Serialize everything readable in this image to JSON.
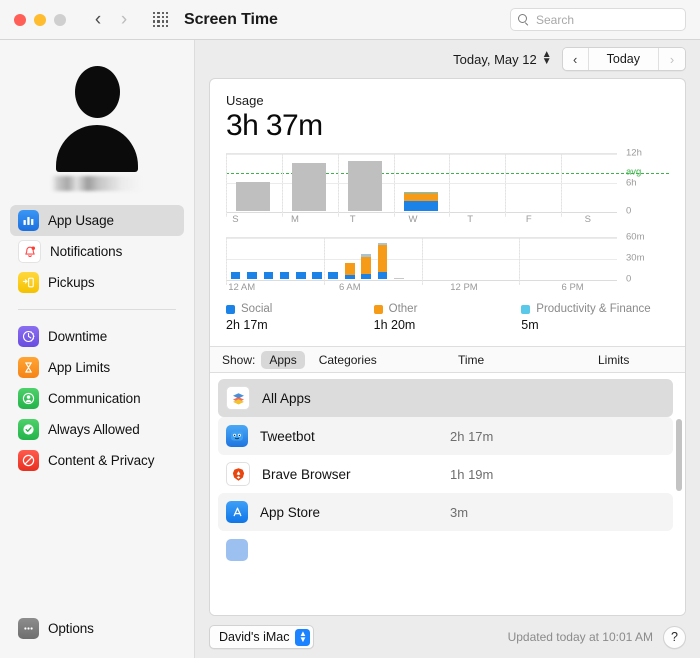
{
  "window": {
    "title": "Screen Time",
    "traffic_lights": [
      "close-button",
      "minimize-button",
      "maximize-button"
    ],
    "grid_icon": "show-all-preferences-icon",
    "back_icon": "‹",
    "forward_icon": "›"
  },
  "search": {
    "value": "",
    "placeholder": "Search",
    "icon": "search-icon"
  },
  "sidebar": {
    "avatar": "user-avatar-silhouette",
    "username": "",
    "items": [
      {
        "label": "App Usage",
        "icon": "chart-bar-icon",
        "selected": true
      },
      {
        "label": "Notifications",
        "icon": "bell-icon",
        "selected": false
      },
      {
        "label": "Pickups",
        "icon": "pickup-hand-icon",
        "selected": false
      },
      {
        "label": "Downtime",
        "icon": "clock-moon-icon",
        "selected": false
      },
      {
        "label": "App Limits",
        "icon": "hourglass-icon",
        "selected": false
      },
      {
        "label": "Communication",
        "icon": "person-circle-icon",
        "selected": false
      },
      {
        "label": "Always Allowed",
        "icon": "checkmark-circle-icon",
        "selected": false
      },
      {
        "label": "Content & Privacy",
        "icon": "no-entry-icon",
        "selected": false
      }
    ],
    "options": {
      "label": "Options",
      "icon": "ellipsis-icon"
    }
  },
  "datebar": {
    "date_label": "Today, May 12",
    "stepper_icon": "up-down-chevron-icon",
    "prev_label": "‹",
    "today_label": "Today",
    "next_label": "›",
    "next_disabled": true
  },
  "usage": {
    "title": "Usage",
    "total": "3h 37m"
  },
  "legend": [
    {
      "name": "Social",
      "value": "2h 17m",
      "color": "#1b83e8"
    },
    {
      "name": "Other",
      "value": "1h 20m",
      "color": "#f59b18"
    },
    {
      "name": "Productivity & Finance",
      "value": "5m",
      "color": "#5ac8e8"
    }
  ],
  "chart_data": [
    {
      "type": "bar",
      "name": "weekly-usage-chart",
      "title": "Usage",
      "categories": [
        "S",
        "M",
        "T",
        "W",
        "T",
        "F",
        "S"
      ],
      "yticks": [
        "0",
        "6h",
        "12h"
      ],
      "ylim": [
        0,
        12
      ],
      "ylabel": "",
      "xlabel": "",
      "grid": true,
      "annotations": [
        {
          "label": "avg",
          "value": 6.8,
          "color": "#3cb44a",
          "style": "dashed"
        }
      ],
      "series": [
        {
          "name": "Total",
          "color": "#bfbfbf",
          "values": [
            6.0,
            10.0,
            10.4,
            0,
            0,
            0,
            0
          ]
        },
        {
          "name": "Social",
          "color": "#1b83e8",
          "values": [
            0,
            0,
            0,
            2.28,
            0,
            0,
            0
          ]
        },
        {
          "name": "Other",
          "color": "#f59b18",
          "values": [
            0,
            0,
            0,
            1.33,
            0,
            0,
            0
          ]
        },
        {
          "name": "Productivity & Finance",
          "color": "#5ac8e8",
          "values": [
            0,
            0,
            0,
            0.08,
            0,
            0,
            0
          ]
        }
      ]
    },
    {
      "type": "bar",
      "name": "hourly-usage-chart",
      "categories": [
        "12 AM",
        "1 AM",
        "2 AM",
        "3 AM",
        "4 AM",
        "5 AM",
        "6 AM",
        "7 AM",
        "8 AM",
        "9 AM",
        "10 AM",
        "11 AM",
        "12 PM",
        "1 PM",
        "2 PM",
        "3 PM",
        "4 PM",
        "5 PM",
        "6 PM",
        "7 PM",
        "8 PM",
        "9 PM",
        "10 PM",
        "11 PM"
      ],
      "xticks": [
        "12 AM",
        "6 AM",
        "12 PM",
        "6 PM"
      ],
      "yticks": [
        "0",
        "30m",
        "60m"
      ],
      "ylim": [
        0,
        60
      ],
      "grid": true,
      "series": [
        {
          "name": "Social",
          "color": "#1b83e8",
          "values": [
            10,
            10,
            10,
            10,
            10,
            10,
            10,
            5,
            7,
            9,
            0,
            0,
            0,
            0,
            0,
            0,
            0,
            0,
            0,
            0,
            0,
            0,
            0,
            0
          ]
        },
        {
          "name": "Other",
          "color": "#f59b18",
          "values": [
            0,
            0,
            0,
            0,
            0,
            0,
            0,
            17,
            26,
            41,
            1,
            0,
            0,
            0,
            0,
            0,
            0,
            0,
            0,
            0,
            0,
            0,
            0,
            0
          ]
        },
        {
          "name": "Productivity & Finance",
          "color": "#5ac8e8",
          "values": [
            0,
            0,
            0,
            0,
            0,
            0,
            0,
            0,
            4,
            2,
            0,
            0,
            0,
            0,
            0,
            0,
            0,
            0,
            0,
            0,
            0,
            0,
            0,
            0
          ]
        }
      ]
    }
  ],
  "showbar": {
    "label": "Show:",
    "tabs": [
      {
        "label": "Apps",
        "selected": true
      },
      {
        "label": "Categories",
        "selected": false
      }
    ],
    "columns": [
      {
        "label": "Time"
      },
      {
        "label": "Limits"
      }
    ]
  },
  "applist": [
    {
      "name": "All Apps",
      "time": "",
      "icon": "stacked-layers-icon",
      "selected": true
    },
    {
      "name": "Tweetbot",
      "time": "2h 17m",
      "icon": "tweetbot-icon",
      "selected": false
    },
    {
      "name": "Brave Browser",
      "time": "1h 19m",
      "icon": "brave-browser-icon",
      "selected": false
    },
    {
      "name": "App Store",
      "time": "3m",
      "icon": "app-store-icon",
      "selected": false
    }
  ],
  "bottombar": {
    "device": "David's iMac",
    "device_arrows_icon": "up-down-chevron-icon",
    "updated": "Updated today at 10:01 AM",
    "help_label": "?"
  }
}
